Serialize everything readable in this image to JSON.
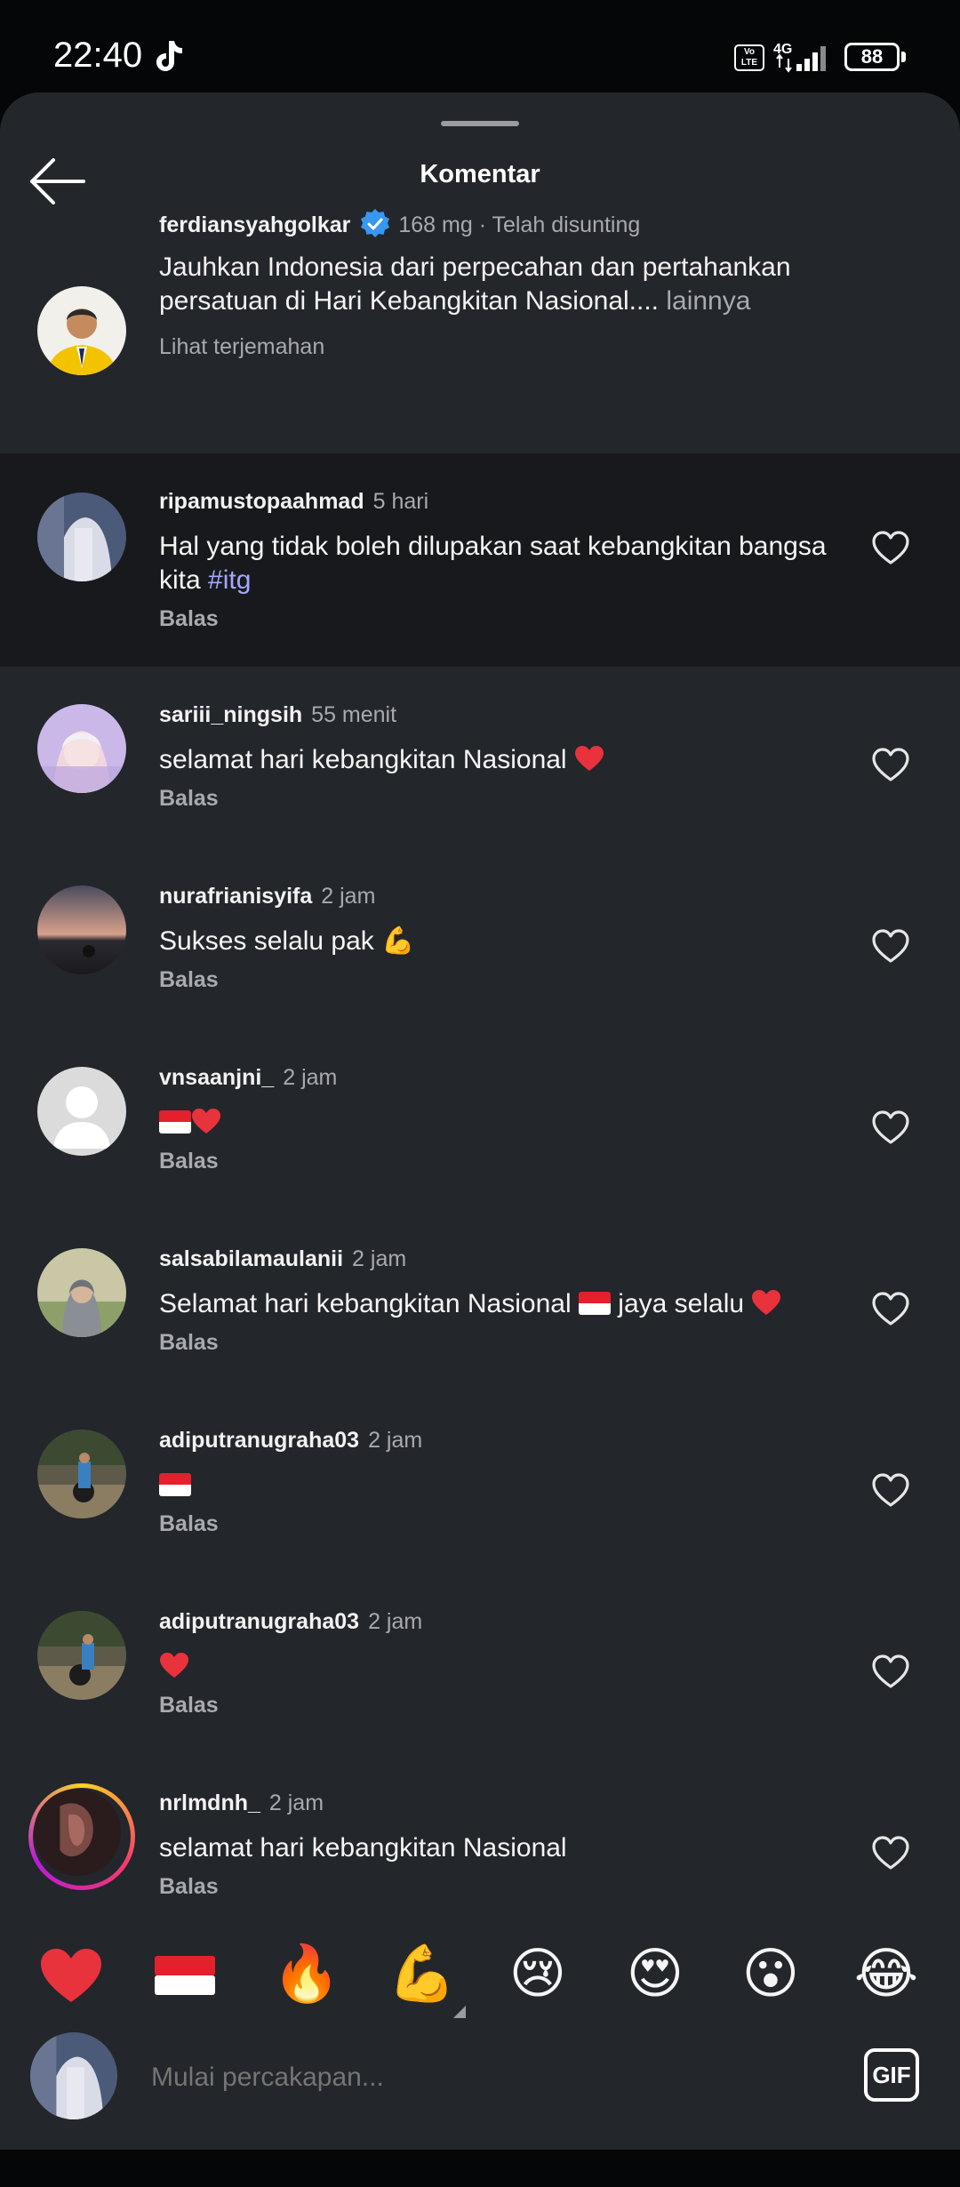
{
  "status": {
    "time": "22:40",
    "volte": "Vo LTE",
    "network": "4G",
    "battery": "88"
  },
  "sheet": {
    "title": "Komentar"
  },
  "caption": {
    "username": "ferdiansyahgolkar",
    "meta": "168 mg · Telah disunting",
    "text": "Jauhkan Indonesia dari perpecahan dan pertahankan persatuan di Hari Kebangkitan Nasional....",
    "more_label": " lainnya",
    "translate_label": "Lihat terjemahan"
  },
  "comments": [
    {
      "username": "ripamustopaahmad",
      "time": "5 hari",
      "text": "Hal yang tidak boleh dilupakan saat kebangkitan bangsa kita ",
      "hashtag": "#itg",
      "reply": "Balas"
    },
    {
      "username": "sariii_ningsih",
      "time": "55 menit",
      "text": "selamat hari kebangkitan Nasional",
      "reply": "Balas"
    },
    {
      "username": "nurafrianisyifa",
      "time": "2 jam",
      "text": "Sukses selalu pak",
      "reply": "Balas"
    },
    {
      "username": "vnsaanjni_",
      "time": "2 jam",
      "reply": "Balas"
    },
    {
      "username": "salsabilamaulanii",
      "time": "2 jam",
      "text": "Selamat hari kebangkitan Nasional",
      "text2": "jaya selalu",
      "reply": "Balas"
    },
    {
      "username": "adiputranugraha03",
      "time": "2 jam",
      "reply": "Balas"
    },
    {
      "username": "adiputranugraha03",
      "time": "2 jam",
      "reply": "Balas"
    },
    {
      "username": "nrlmdnh_",
      "time": "2 jam",
      "text": "selamat hari kebangkitan Nasional",
      "reply": "Balas"
    }
  ],
  "emoji_bar": [
    "heart",
    "indonesia-flag",
    "fire",
    "flexed-biceps",
    "crying-face",
    "heart-eyes",
    "surprised-face",
    "tears-of-joy"
  ],
  "composer": {
    "placeholder": "Mulai percakapan...",
    "gif_label": "GIF"
  },
  "colors": {
    "sheet_bg": "#23262b",
    "highlight_bg": "#18191c",
    "hashtag": "#a3a7ff",
    "verified": "#3897f0",
    "secondary_text": "#a8aaae"
  }
}
